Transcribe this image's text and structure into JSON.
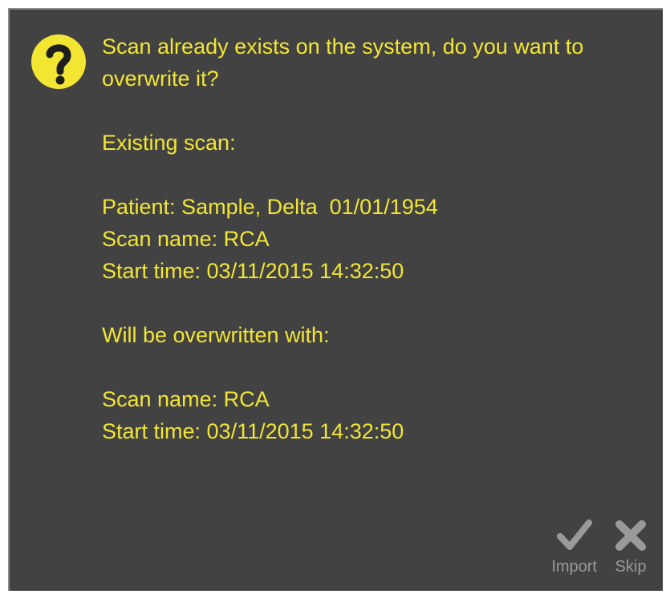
{
  "dialog": {
    "icon": "question-icon",
    "question_line1": "Scan already exists on the system, do you want to",
    "question_line2": "overwrite it?",
    "existing_heading": "Existing scan:",
    "existing_patient": "Patient: Sample, Delta  01/01/1954",
    "existing_scan_name": "Scan name: RCA",
    "existing_start_time": "Start time: 03/11/2015 14:32:50",
    "overwrite_heading": "Will be overwritten with:",
    "new_scan_name": "Scan name: RCA",
    "new_start_time": "Start time: 03/11/2015 14:32:50"
  },
  "actions": {
    "import_label": "Import",
    "import_icon": "checkmark-icon",
    "skip_label": "Skip",
    "skip_icon": "close-icon"
  },
  "colors": {
    "background": "#424242",
    "text": "#f2e633",
    "icon": "#f2e633",
    "button": "#9a9a9a"
  }
}
